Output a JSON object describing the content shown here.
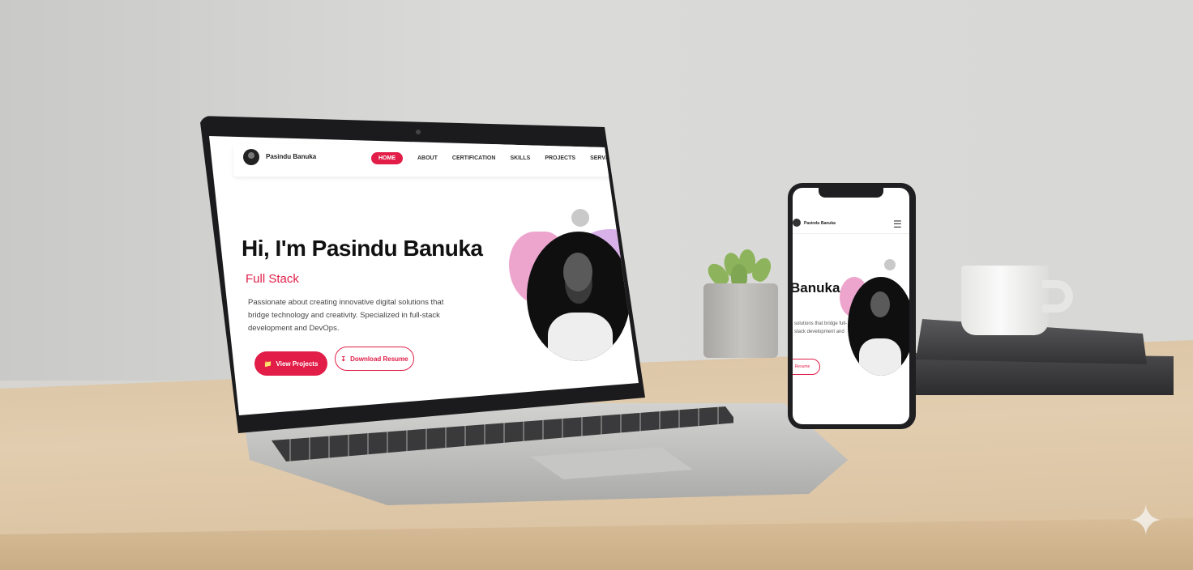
{
  "laptop": {
    "brand": "Pasindu Banuka",
    "nav": [
      "HOME",
      "ABOUT",
      "CERTIFICATION",
      "SKILLS",
      "PROJECTS",
      "SERVICES"
    ],
    "title": "Hi, I'm Pasindu Banuka",
    "subtitle": "Full Stack",
    "description": "Passionate about creating innovative digital solutions that bridge technology and creativity. Specialized in full-stack development and DevOps.",
    "primary_button": "View Projects",
    "secondary_button": "Download Resume"
  },
  "phone": {
    "brand": "Pasindu Banuka",
    "title_fragment": "Banuka",
    "description_fragment": "solutions that bridge full-stack development and",
    "button_fragment": "Resume"
  },
  "colors": {
    "accent": "#e11d48",
    "blob_pink": "#e98fc2",
    "blob_purple": "#d7b1e8"
  },
  "icons": {
    "menu": "hamburger-icon",
    "project": "folder-icon",
    "download": "download-icon",
    "watermark": "sparkle-icon"
  }
}
